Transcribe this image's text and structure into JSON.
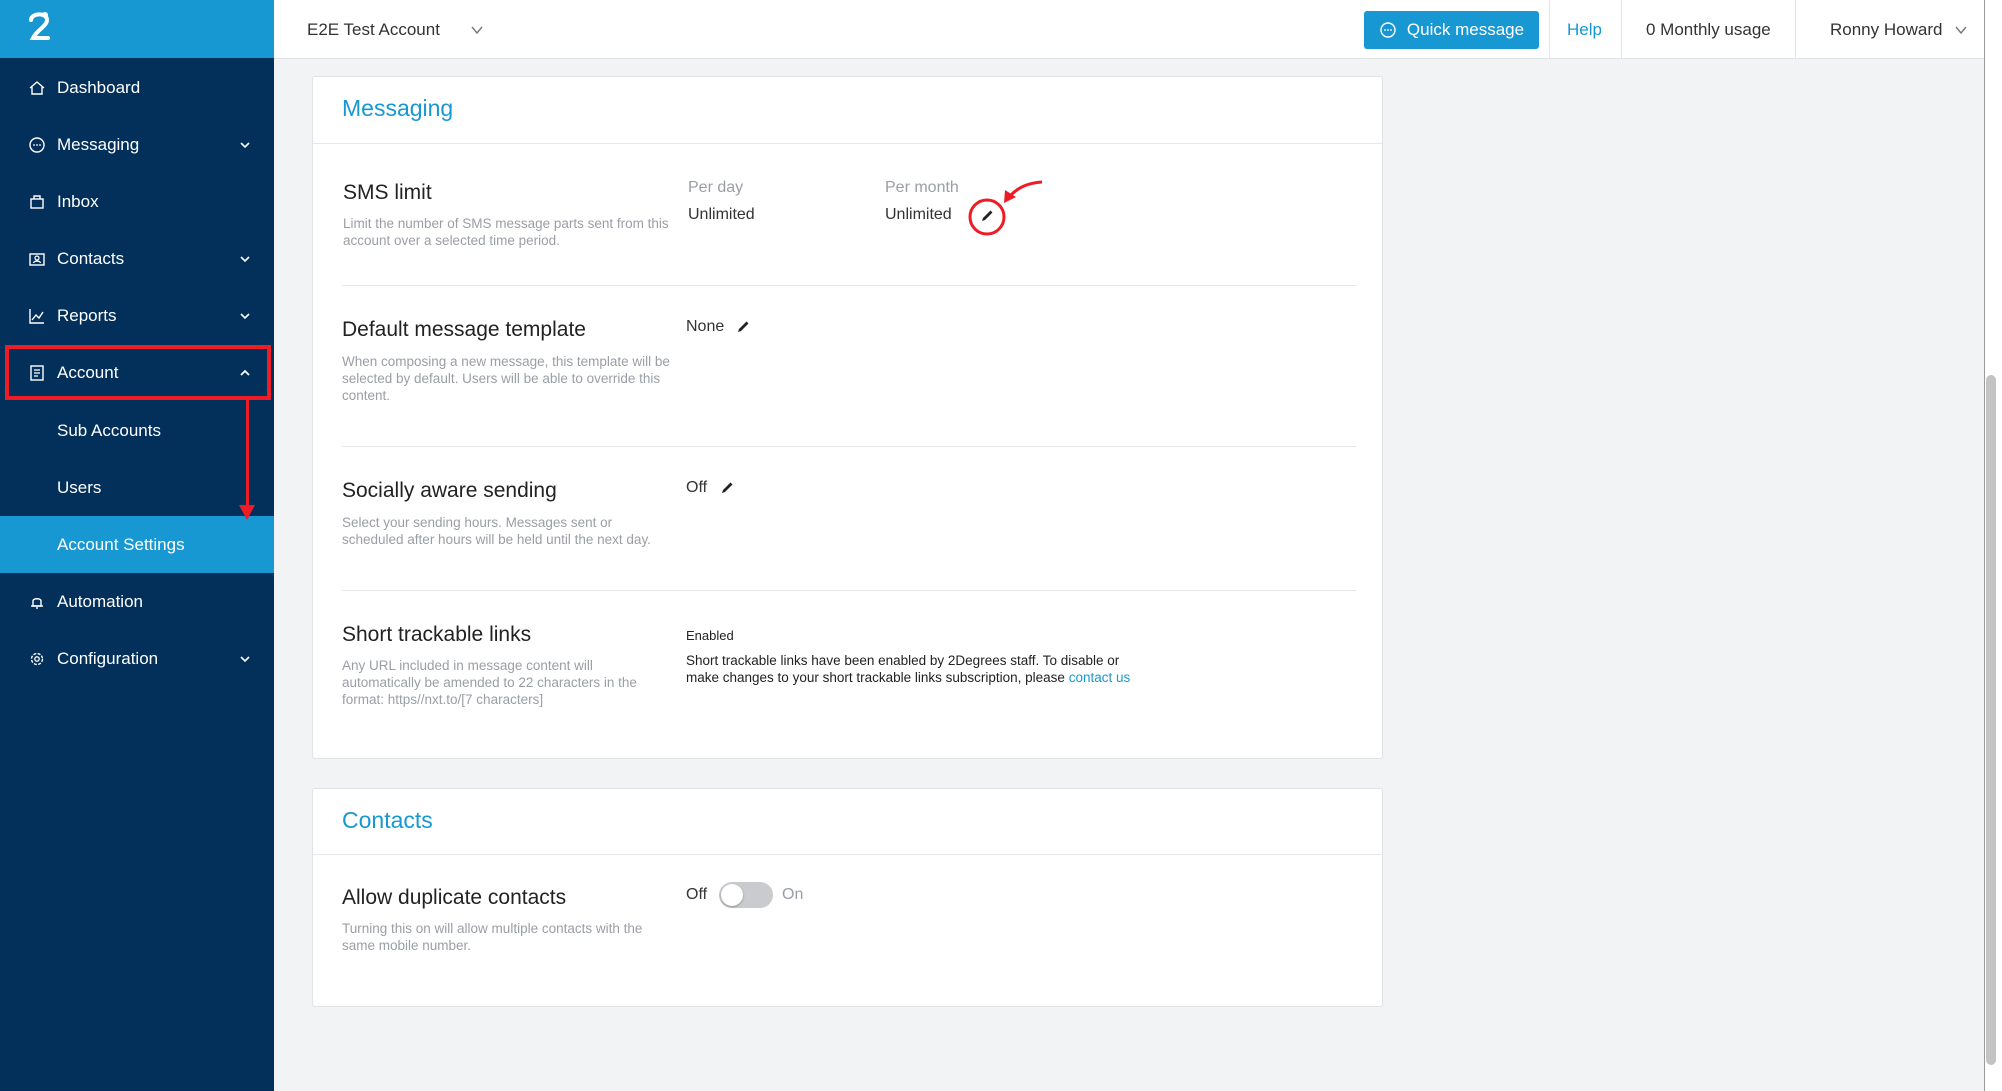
{
  "topbar": {
    "account_name": "E2E Test Account",
    "quick_message_label": "Quick message",
    "help_label": "Help",
    "monthly_usage": "0 Monthly usage",
    "user_name": "Ronny Howard"
  },
  "sidebar": {
    "items": [
      {
        "label": "Dashboard"
      },
      {
        "label": "Messaging"
      },
      {
        "label": "Inbox"
      },
      {
        "label": "Contacts"
      },
      {
        "label": "Reports"
      },
      {
        "label": "Account"
      },
      {
        "label": "Sub Accounts"
      },
      {
        "label": "Users"
      },
      {
        "label": "Account Settings"
      },
      {
        "label": "Automation"
      },
      {
        "label": "Configuration"
      }
    ]
  },
  "messaging": {
    "title": "Messaging",
    "sms_limit": {
      "title": "SMS limit",
      "description": "Limit the number of SMS message parts sent from this account over a selected time period.",
      "per_day_label": "Per day",
      "per_day_value": "Unlimited",
      "per_month_label": "Per month",
      "per_month_value": "Unlimited"
    },
    "default_template": {
      "title": "Default message template",
      "description": "When composing a new message, this template will be selected by default. Users will be able to override this content.",
      "value": "None"
    },
    "socially_aware": {
      "title": "Socially aware sending",
      "description": "Select your sending hours. Messages sent or scheduled after hours will be held until the next day.",
      "value": "Off"
    },
    "short_links": {
      "title": "Short trackable links",
      "description": "Any URL included in message content will automatically be amended to 22 characters in the format: https//nxt.to/[7 characters]",
      "status": "Enabled",
      "note": "Short trackable links have been enabled by 2Degrees staff. To disable or make changes to your short trackable links subscription, please",
      "link_text": "contact us"
    }
  },
  "contacts": {
    "title": "Contacts",
    "duplicates": {
      "title": "Allow duplicate contacts",
      "description": "Turning this on will allow multiple contacts with the same mobile number.",
      "off_label": "Off",
      "on_label": "On",
      "enabled": false
    }
  },
  "colors": {
    "sidebar_bg": "#03305a",
    "accent": "#1798d3",
    "annotation_red": "#ee1c25"
  }
}
